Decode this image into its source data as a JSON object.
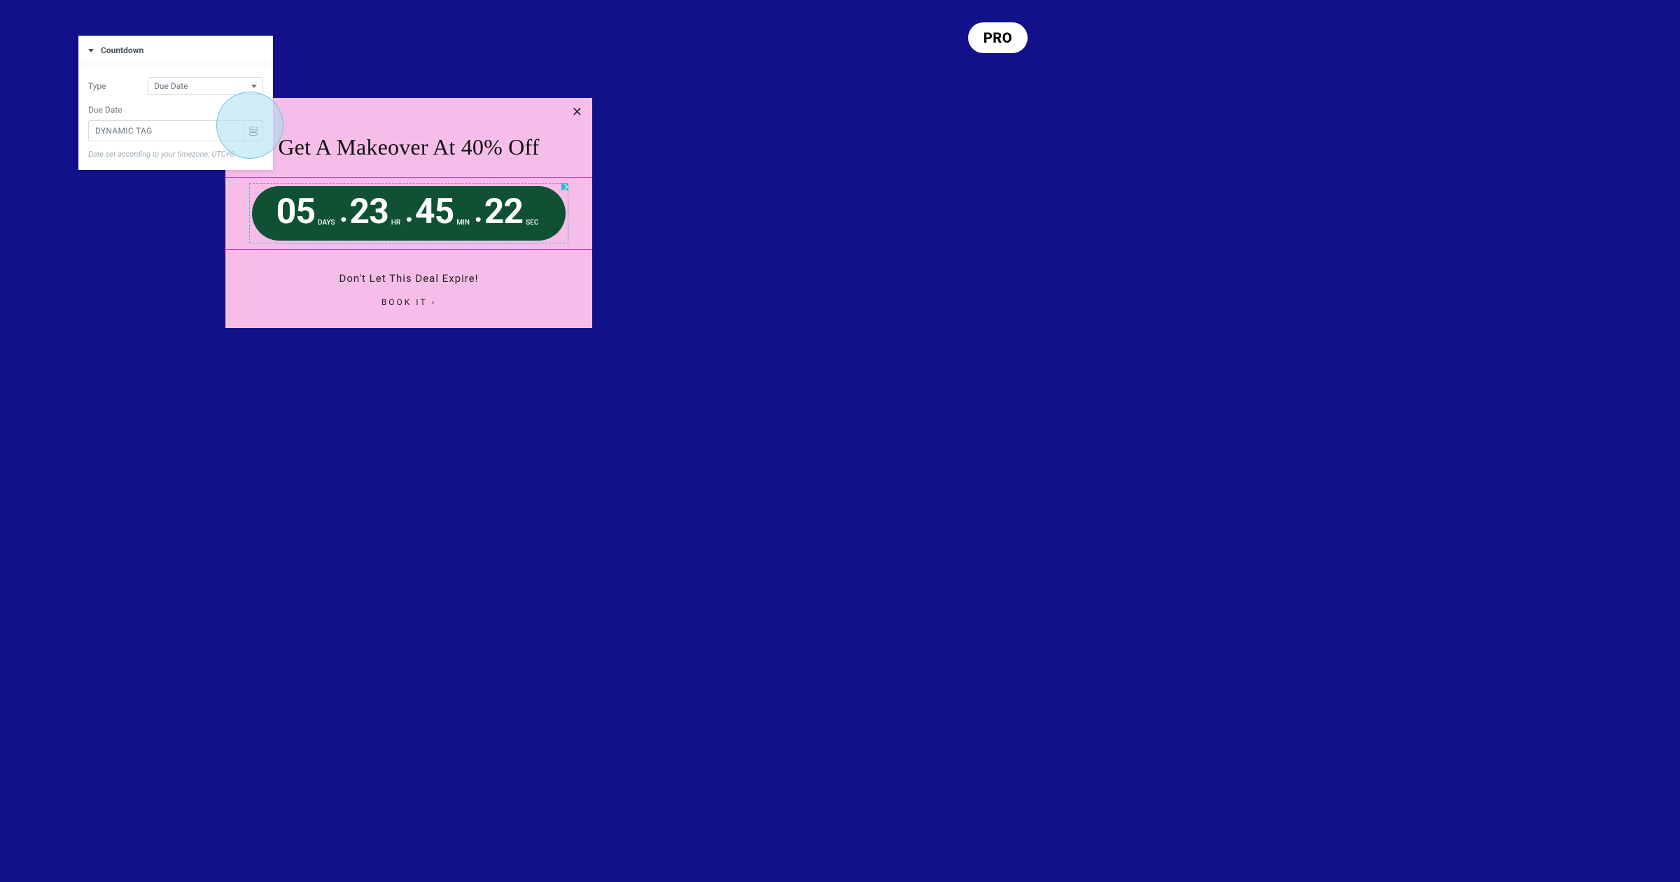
{
  "badge": {
    "pro": "PRO"
  },
  "panel": {
    "title": "Countdown",
    "type_label": "Type",
    "type_value": "Due Date",
    "due_date_label": "Due Date",
    "due_date_value": "DYNAMIC TAG",
    "hint": "Date set according to your timezone: UTC+0."
  },
  "popup": {
    "title": "Get A Makeover At 40% Off",
    "countdown": {
      "days": "05",
      "days_label": "DAYS",
      "hours": "23",
      "hours_label": "HR",
      "minutes": "45",
      "minutes_label": "MIN",
      "seconds": "22",
      "seconds_label": "SEC"
    },
    "subtitle": "Don't Let This Deal Expire!",
    "cta": "BOOK IT"
  }
}
